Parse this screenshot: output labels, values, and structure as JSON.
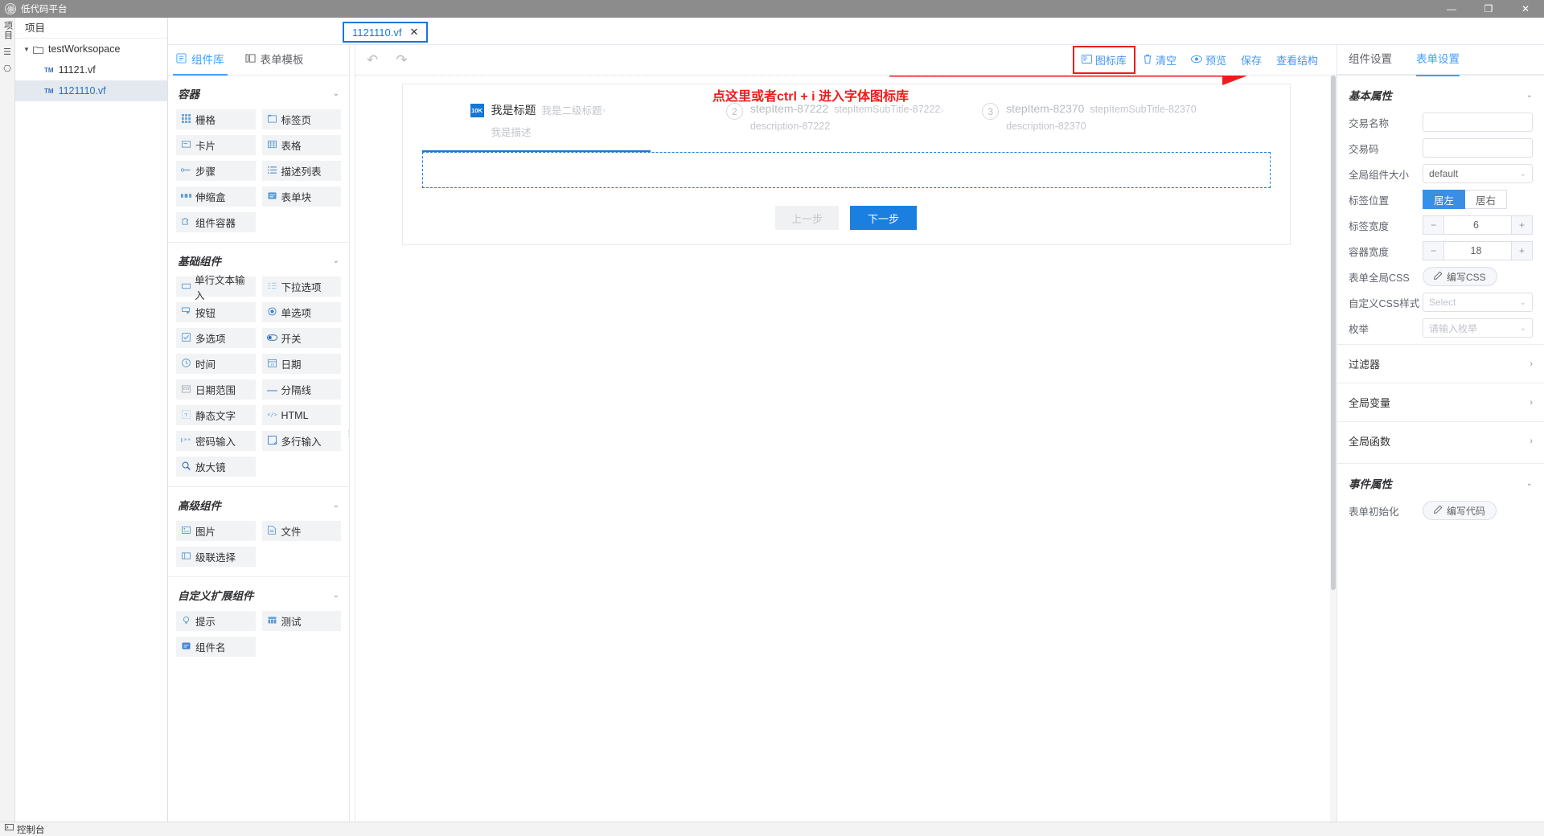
{
  "window": {
    "title": "低代码平台",
    "app_icon": "atom-icon",
    "controls": {
      "minimize": "—",
      "maximize": "❐",
      "close": "✕"
    }
  },
  "rail": {
    "vertical_label": "项目",
    "icons": [
      "list-icon",
      "monitor-icon"
    ]
  },
  "tree": {
    "title": "项目",
    "root": {
      "label": "testWorksopace",
      "icon": "folder-icon",
      "expanded": true
    },
    "children": [
      {
        "label": "11121.vf",
        "badge": "TM",
        "selected": false
      },
      {
        "label": "1121110.vf",
        "badge": "TM",
        "selected": true
      }
    ]
  },
  "file_tab": {
    "name": "1121110.vf",
    "close": "✕"
  },
  "lib_tabs": [
    {
      "label": "组件库",
      "icon": "components-icon",
      "active": true
    },
    {
      "label": "表单模板",
      "icon": "template-icon",
      "active": false
    }
  ],
  "library": [
    {
      "title": "容器",
      "chevron": "⌄",
      "items": [
        {
          "label": "栅格",
          "icon": "grid-icon"
        },
        {
          "label": "标签页",
          "icon": "tabs-icon"
        },
        {
          "label": "卡片",
          "icon": "card-icon"
        },
        {
          "label": "表格",
          "icon": "table-icon"
        },
        {
          "label": "步骤",
          "icon": "steps-icon"
        },
        {
          "label": "描述列表",
          "icon": "description-list-icon"
        },
        {
          "label": "伸缩盒",
          "icon": "flexbox-icon"
        },
        {
          "label": "表单块",
          "icon": "form-block-icon"
        },
        {
          "label": "组件容器",
          "icon": "component-container-icon"
        }
      ]
    },
    {
      "title": "基础组件",
      "chevron": "⌄",
      "items": [
        {
          "label": "单行文本输入",
          "icon": "text-input-icon"
        },
        {
          "label": "下拉选项",
          "icon": "dropdown-icon"
        },
        {
          "label": "按钮",
          "icon": "button-icon"
        },
        {
          "label": "单选项",
          "icon": "radio-icon"
        },
        {
          "label": "多选项",
          "icon": "checkbox-icon"
        },
        {
          "label": "开关",
          "icon": "switch-icon"
        },
        {
          "label": "时间",
          "icon": "clock-icon"
        },
        {
          "label": "日期",
          "icon": "calendar-icon"
        },
        {
          "label": "日期范围",
          "icon": "date-range-icon"
        },
        {
          "label": "分隔线",
          "icon": "divider-icon"
        },
        {
          "label": "静态文字",
          "icon": "static-text-icon"
        },
        {
          "label": "HTML",
          "icon": "code-icon"
        },
        {
          "label": "密码输入",
          "icon": "password-icon"
        },
        {
          "label": "多行输入",
          "icon": "textarea-icon"
        },
        {
          "label": "放大镜",
          "icon": "magnifier-icon"
        }
      ]
    },
    {
      "title": "高级组件",
      "chevron": "⌄",
      "items": [
        {
          "label": "图片",
          "icon": "image-icon"
        },
        {
          "label": "文件",
          "icon": "file-icon"
        },
        {
          "label": "级联选择",
          "icon": "cascader-icon"
        }
      ]
    },
    {
      "title": "自定义扩展组件",
      "chevron": "⌄",
      "items": [
        {
          "label": "提示",
          "icon": "tip-icon"
        },
        {
          "label": "测试",
          "icon": "test-icon"
        },
        {
          "label": "组件名",
          "icon": "component-name-icon"
        }
      ]
    }
  ],
  "canvas_toolbar": {
    "undo": "undo-icon",
    "redo": "redo-icon",
    "buttons": [
      {
        "label": "图标库",
        "icon": "icon-library-icon",
        "highlighted": true
      },
      {
        "label": "清空",
        "icon": "trash-icon",
        "highlighted": false
      },
      {
        "label": "预览",
        "icon": "eye-icon",
        "highlighted": false
      },
      {
        "label": "保存",
        "icon": "",
        "highlighted": false
      },
      {
        "label": "查看结构",
        "icon": "",
        "highlighted": false
      }
    ]
  },
  "annotation": {
    "text": "点这里或者ctrl + i 进入字体图标库",
    "color": "#ef1c1c",
    "arrow": "arrow-right"
  },
  "form": {
    "steps": [
      {
        "bullet_type": "square-icon",
        "bullet_text": "10K",
        "title": "我是标题",
        "subtitle": "我是二级标题",
        "description": "我是描述",
        "active": true
      },
      {
        "bullet_type": "circle",
        "bullet_text": "2",
        "title": "stepItem-87222",
        "subtitle": "stepItemSubTitle-87222",
        "description": "description-87222",
        "active": false
      },
      {
        "bullet_type": "circle",
        "bullet_text": "3",
        "title": "stepItem-82370",
        "subtitle": "stepItemSubTitle-82370",
        "description": "description-82370",
        "active": false
      }
    ],
    "prev_button": "上一步",
    "next_button": "下一步"
  },
  "props": {
    "tabs": [
      {
        "label": "组件设置",
        "active": false
      },
      {
        "label": "表单设置",
        "active": true
      }
    ],
    "basic": {
      "title": "基本属性",
      "chevron": "⌄",
      "rows": [
        {
          "label": "交易名称",
          "type": "input",
          "value": "",
          "placeholder": ""
        },
        {
          "label": "交易码",
          "type": "input",
          "value": "",
          "placeholder": ""
        },
        {
          "label": "全局组件大小",
          "type": "select",
          "value": "default",
          "chevron": "⌄"
        },
        {
          "label": "标签位置",
          "type": "segment",
          "options": [
            "居左",
            "居右"
          ],
          "selected": "居左"
        },
        {
          "label": "标签宽度",
          "type": "stepper",
          "value": "6",
          "minus": "−",
          "plus": "+"
        },
        {
          "label": "容器宽度",
          "type": "stepper",
          "value": "18",
          "minus": "−",
          "plus": "+"
        },
        {
          "label": "表单全局CSS",
          "type": "button",
          "value": "编写CSS",
          "icon": "edit-icon"
        },
        {
          "label": "自定义CSS样式",
          "type": "select",
          "value": "",
          "placeholder": "Select",
          "chevron": "⌄"
        },
        {
          "label": "枚举",
          "type": "select",
          "value": "",
          "placeholder": "请输入枚举",
          "chevron": "⌄"
        }
      ]
    },
    "collapsibles": [
      {
        "label": "过滤器",
        "chevron": "›"
      },
      {
        "label": "全局变量",
        "chevron": "›"
      },
      {
        "label": "全局函数",
        "chevron": "›"
      }
    ],
    "events": {
      "title": "事件属性",
      "chevron": "⌄",
      "rows": [
        {
          "label": "表单初始化",
          "type": "button",
          "value": "编写代码",
          "icon": "edit-icon"
        }
      ]
    }
  },
  "statusbar": {
    "label": "控制台",
    "icon": "console-icon"
  },
  "colors": {
    "accent": "#409eff",
    "primary_button": "#1b7fe0",
    "annotation_red": "#ef1c1c",
    "titlebar": "#8c8c8c",
    "panel_bg": "#f2f3f5"
  }
}
